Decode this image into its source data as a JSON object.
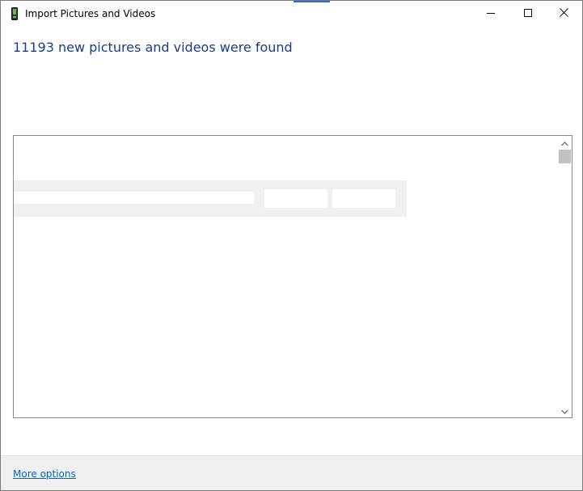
{
  "window": {
    "title": "Import Pictures and Videos"
  },
  "heading": "11193 new pictures and videos were found",
  "footer": {
    "more_options_link": "More options"
  },
  "icons": {
    "app": "import-device-icon",
    "minimize": "minimize-icon",
    "maximize": "maximize-icon",
    "close": "close-icon",
    "scroll_up": "chevron-up-icon",
    "scroll_down": "chevron-down-icon"
  },
  "colors": {
    "heading": "#1a3c8c",
    "link": "#0066cc",
    "footer_bg": "#f0f0f0",
    "accent": "#2b6cb8"
  }
}
